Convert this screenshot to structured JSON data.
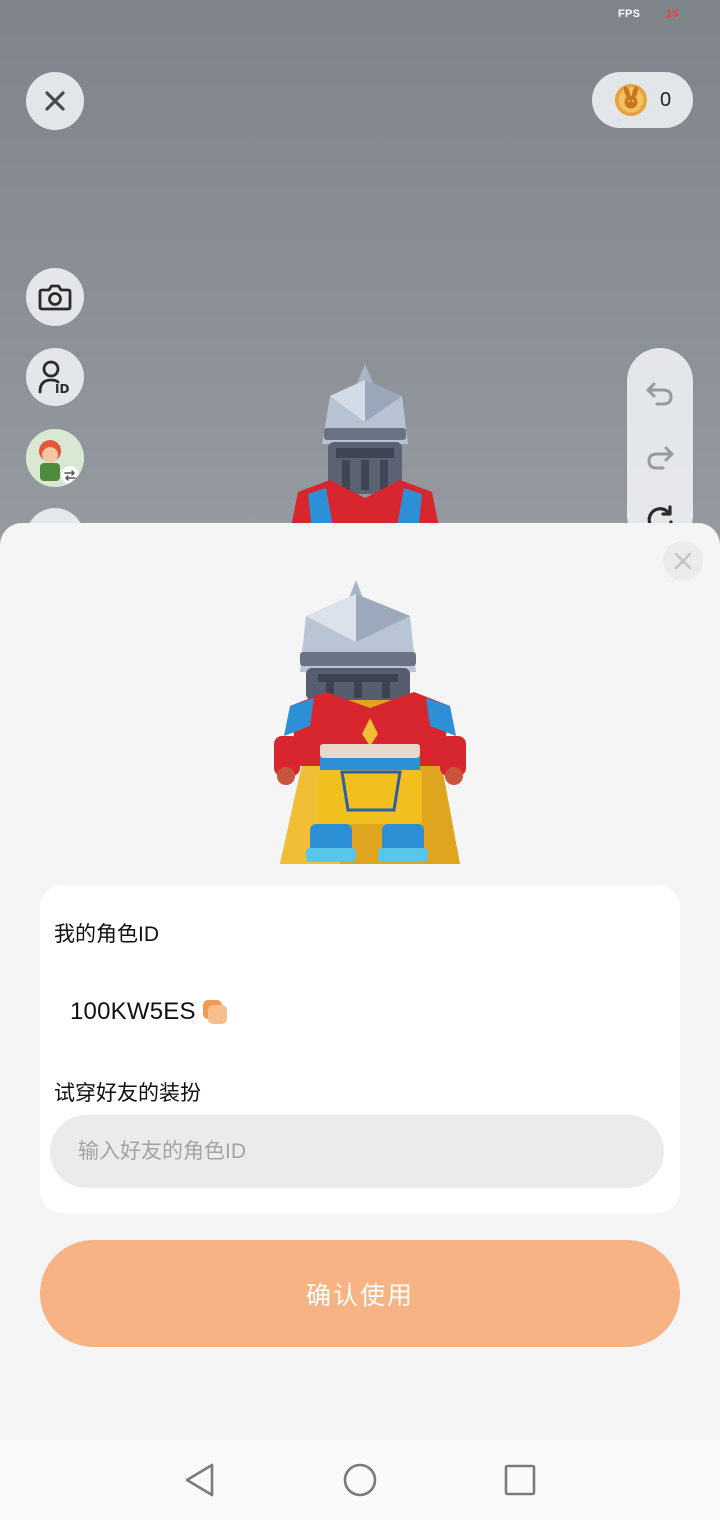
{
  "status": {
    "fps_label": "FPS",
    "fps_value": "15"
  },
  "wallet": {
    "coin_count": "0",
    "coin_icon": "bunny-coin-icon"
  },
  "side_tools": [
    {
      "name": "camera-icon"
    },
    {
      "name": "role-id-icon"
    },
    {
      "name": "avatar-switch-icon"
    }
  ],
  "history_tools": [
    {
      "name": "undo-icon"
    },
    {
      "name": "redo-icon"
    },
    {
      "name": "rotate-icon"
    }
  ],
  "sheet": {
    "my_id_label": "我的角色ID",
    "my_id_value": "100KW5ES",
    "try_on_label": "试穿好友的装扮",
    "friend_input_placeholder": "输入好友的角色ID",
    "confirm_label": "确认使用"
  },
  "colors": {
    "accent": "#f7b383",
    "sheet_bg": "#f5f5f5",
    "card_bg": "#ffffff",
    "input_bg": "#ebebeb",
    "scene_bg": "#8a8f96"
  }
}
